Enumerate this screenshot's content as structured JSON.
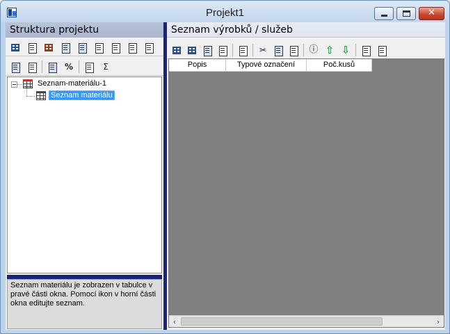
{
  "window": {
    "title": "Projekt1"
  },
  "left_pane": {
    "header": "Struktura projektu",
    "toolbar1": [
      {
        "name": "new-table-icon"
      },
      {
        "name": "table-view-icon"
      },
      {
        "name": "table-red-icon"
      },
      {
        "name": "copy-table-icon"
      },
      {
        "name": "table-two-icon"
      },
      {
        "name": "table-three-icon"
      },
      {
        "name": "move-up-icon"
      },
      {
        "name": "move-down-icon"
      },
      {
        "name": "delete-icon"
      }
    ],
    "toolbar2": [
      {
        "name": "copy-icon"
      },
      {
        "name": "paste-icon"
      },
      {
        "name": "properties-icon",
        "text": ""
      },
      {
        "name": "percent-icon",
        "text": "%"
      },
      {
        "name": "calculate-icon"
      },
      {
        "name": "sum-icon",
        "text": "Σ"
      }
    ],
    "tree": {
      "root_label": "Seznam-materiálu-1",
      "child_label": "Seznam materiálu"
    },
    "info_text": "Seznam materiálu je zobrazen v tabulce v pravé části okna. Pomocí ikon v horní části okna editujte seznam."
  },
  "right_pane": {
    "header": "Seznam výrobků / služeb",
    "toolbar": [
      {
        "name": "insert-row-icon"
      },
      {
        "name": "insert-child-row-icon"
      },
      {
        "name": "find-icon"
      },
      {
        "name": "delete-row-icon"
      },
      {
        "name": "export-icon"
      },
      {
        "name": "cut-icon",
        "text": "✂"
      },
      {
        "name": "copy-icon"
      },
      {
        "name": "paste-icon"
      },
      {
        "name": "info-icon",
        "text": "ⓘ"
      },
      {
        "name": "move-row-up-icon",
        "text": "⇧"
      },
      {
        "name": "move-row-down-icon",
        "text": "⇩"
      },
      {
        "name": "duplicate-icon"
      },
      {
        "name": "clear-icon"
      }
    ],
    "columns": [
      "Popis",
      "Typové označení",
      "Poč.kusů"
    ],
    "scroll_left": "‹",
    "scroll_right": "›"
  },
  "controls": {
    "close": "✕"
  },
  "colors": {
    "accent_dark": "#1a2576",
    "selection": "#3399ff",
    "grid_background": "#808080"
  }
}
